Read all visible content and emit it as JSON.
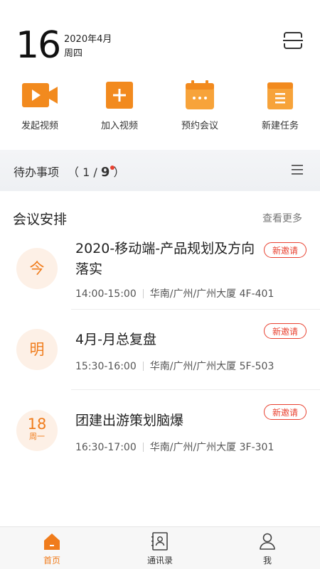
{
  "header": {
    "day": "16",
    "year_month": "2020年4月",
    "weekday": "周四",
    "scan_icon": "scan-icon"
  },
  "actions": [
    {
      "label": "发起视频",
      "icon": "video-start-icon"
    },
    {
      "label": "加入视频",
      "icon": "plus-icon"
    },
    {
      "label": "预约会议",
      "icon": "calendar-icon"
    },
    {
      "label": "新建任务",
      "icon": "task-icon"
    }
  ],
  "todo": {
    "title": "待办事项",
    "current": "1",
    "total": "9",
    "menu_icon": "menu-icon"
  },
  "meetings_section": {
    "title": "会议安排",
    "more_label": "查看更多"
  },
  "meetings": [
    {
      "badge": "今",
      "badge_sub": "",
      "title": "2020-移动端-产品规划及方向落实",
      "time": "14:00-15:00",
      "location": "华南/广州/广州大厦 4F-401",
      "tag": "新邀请"
    },
    {
      "badge": "明",
      "badge_sub": "",
      "title": "4月-月总复盘",
      "time": "15:30-16:00",
      "location": "华南/广州/广州大厦 5F-503",
      "tag": "新邀请"
    },
    {
      "badge": "18",
      "badge_sub": "周一",
      "title": "团建出游策划脑爆",
      "time": "16:30-17:00",
      "location": "华南/广州/广州大厦 3F-301",
      "tag": "新邀请"
    }
  ],
  "nav": [
    {
      "label": "首页",
      "icon": "home-icon",
      "active": true
    },
    {
      "label": "通讯录",
      "icon": "contacts-icon",
      "active": false
    },
    {
      "label": "我",
      "icon": "profile-icon",
      "active": false
    }
  ],
  "colors": {
    "accent": "#f07c1c",
    "badge_bg": "#fdf0e6",
    "tag_red": "#e8402f"
  }
}
